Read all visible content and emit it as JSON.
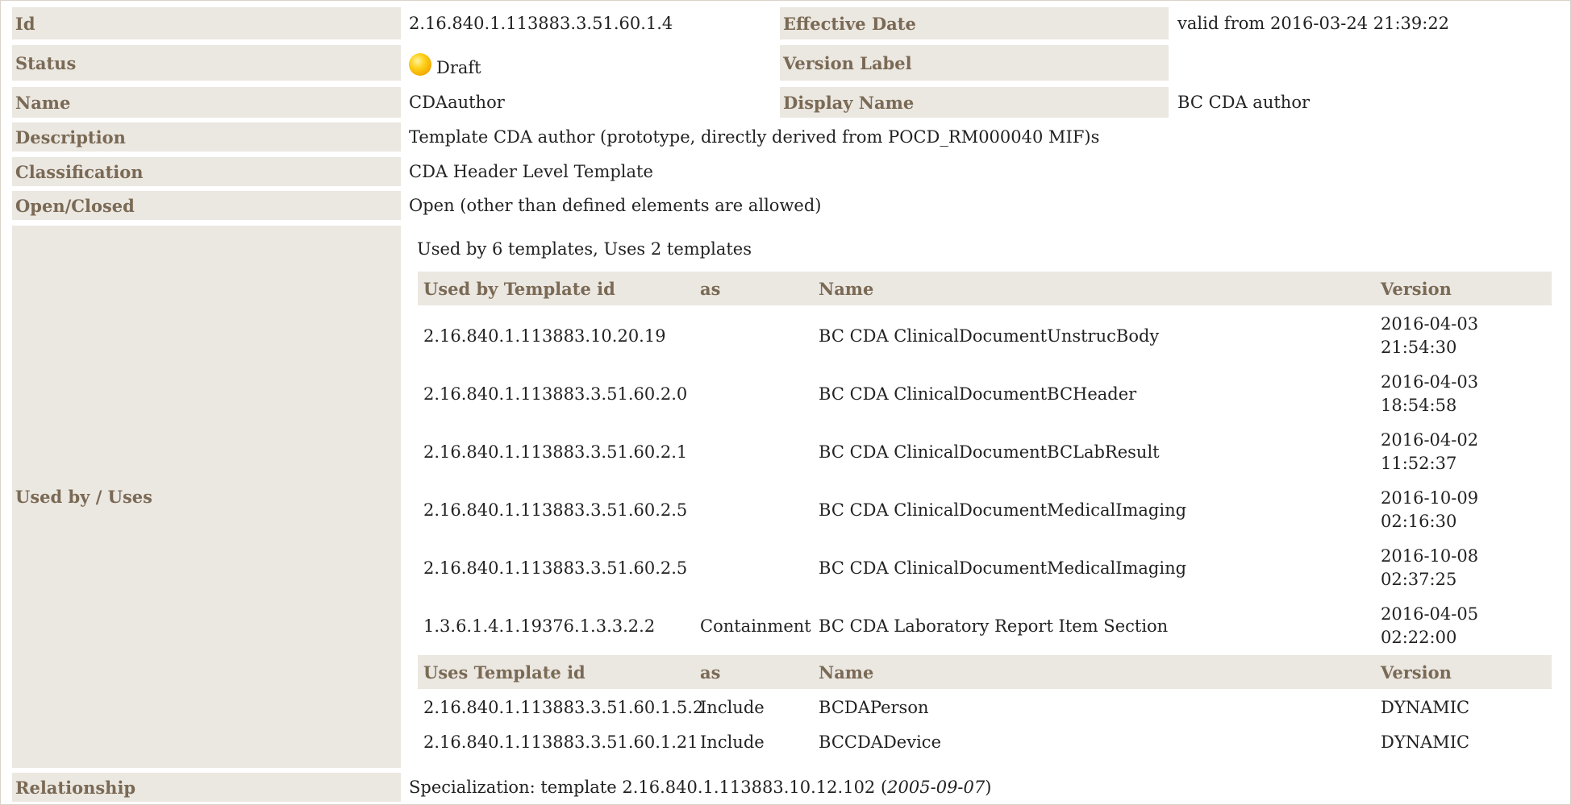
{
  "rows": {
    "id": {
      "label": "Id",
      "value": "2.16.840.1.113883.3.51.60.1.4"
    },
    "effective_date": {
      "label": "Effective Date",
      "value": "valid from 2016-03-24 21:39:22"
    },
    "status": {
      "label": "Status",
      "value": "Draft",
      "icon": "status-draft-icon",
      "icon_color": "#ffc20e"
    },
    "version_label": {
      "label": "Version Label",
      "value": ""
    },
    "name": {
      "label": "Name",
      "value": "CDAauthor"
    },
    "display_name": {
      "label": "Display Name",
      "value": "BC CDA author"
    },
    "description": {
      "label": "Description",
      "value": "Template CDA author (prototype, directly derived from POCD_RM000040 MIF)s"
    },
    "classification": {
      "label": "Classification",
      "value": "CDA Header Level Template"
    },
    "open_closed": {
      "label": "Open/Closed",
      "value": "Open (other than defined elements are allowed)"
    },
    "used_by_uses": {
      "label": "Used by / Uses",
      "summary": "Used by 6 templates, Uses 2 templates"
    },
    "relationship": {
      "label": "Relationship",
      "prefix": "Specialization: template 2.16.840.1.113883.10.12.102 (",
      "date": "2005-09-07",
      "suffix": ")"
    }
  },
  "used_by_table": {
    "headers": [
      "Used by Template id",
      "as",
      "Name",
      "Version"
    ],
    "rows": [
      {
        "id": "2.16.840.1.113883.10.20.19",
        "as": "",
        "name": "BC CDA ClinicalDocumentUnstrucBody",
        "version_date": "2016-04-03",
        "version_time": "21:54:30"
      },
      {
        "id": "2.16.840.1.113883.3.51.60.2.0",
        "as": "",
        "name": "BC CDA ClinicalDocumentBCHeader",
        "version_date": "2016-04-03",
        "version_time": "18:54:58"
      },
      {
        "id": "2.16.840.1.113883.3.51.60.2.1",
        "as": "",
        "name": "BC CDA ClinicalDocumentBCLabResult",
        "version_date": "2016-04-02",
        "version_time": "11:52:37"
      },
      {
        "id": "2.16.840.1.113883.3.51.60.2.5",
        "as": "",
        "name": "BC CDA ClinicalDocumentMedicalImaging",
        "version_date": "2016-10-09",
        "version_time": "02:16:30"
      },
      {
        "id": "2.16.840.1.113883.3.51.60.2.5",
        "as": "",
        "name": "BC CDA ClinicalDocumentMedicalImaging",
        "version_date": "2016-10-08",
        "version_time": "02:37:25"
      },
      {
        "id": "1.3.6.1.4.1.19376.1.3.3.2.2",
        "as": "Containment",
        "name": "BC CDA Laboratory Report Item Section",
        "version_date": "2016-04-05",
        "version_time": "02:22:00"
      }
    ]
  },
  "uses_table": {
    "headers": [
      "Uses Template id",
      "as",
      "Name",
      "Version"
    ],
    "rows": [
      {
        "id": "2.16.840.1.113883.3.51.60.1.5.2",
        "as": "Include",
        "name": "BCDAPerson",
        "version": "DYNAMIC"
      },
      {
        "id": "2.16.840.1.113883.3.51.60.1.21",
        "as": "Include",
        "name": "BCCDADevice",
        "version": "DYNAMIC"
      }
    ]
  }
}
